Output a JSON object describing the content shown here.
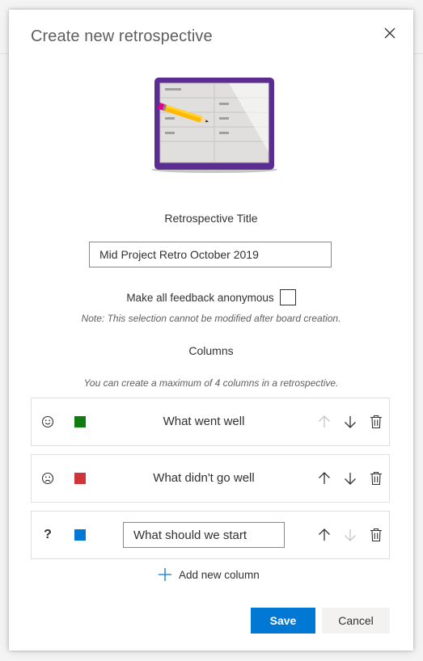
{
  "dialog": {
    "title": "Create new retrospective",
    "close_icon": "close-icon"
  },
  "retro_title": {
    "label": "Retrospective Title",
    "value": "Mid Project Retro October 2019"
  },
  "anonymous": {
    "label": "Make all feedback anonymous",
    "checked": false,
    "note": "Note: This selection cannot be modified after board creation."
  },
  "columns": {
    "label": "Columns",
    "hint": "You can create a maximum of 4 columns in a retrospective.",
    "items": [
      {
        "icon": "smile-icon",
        "color": "#107c10",
        "title": "What went well",
        "editing": false,
        "up_enabled": false,
        "down_enabled": true
      },
      {
        "icon": "frown-icon",
        "color": "#d13438",
        "title": "What didn't go well",
        "editing": false,
        "up_enabled": true,
        "down_enabled": true
      },
      {
        "icon": "question-icon",
        "glyph": "?",
        "color": "#0078d4",
        "title": "What should we start",
        "editing": true,
        "up_enabled": true,
        "down_enabled": false
      }
    ],
    "add_label": "Add new column"
  },
  "actions": {
    "save_label": "Save",
    "cancel_label": "Cancel"
  },
  "colors": {
    "primary": "#0078d4",
    "illustration_frame": "#5c2d91"
  }
}
